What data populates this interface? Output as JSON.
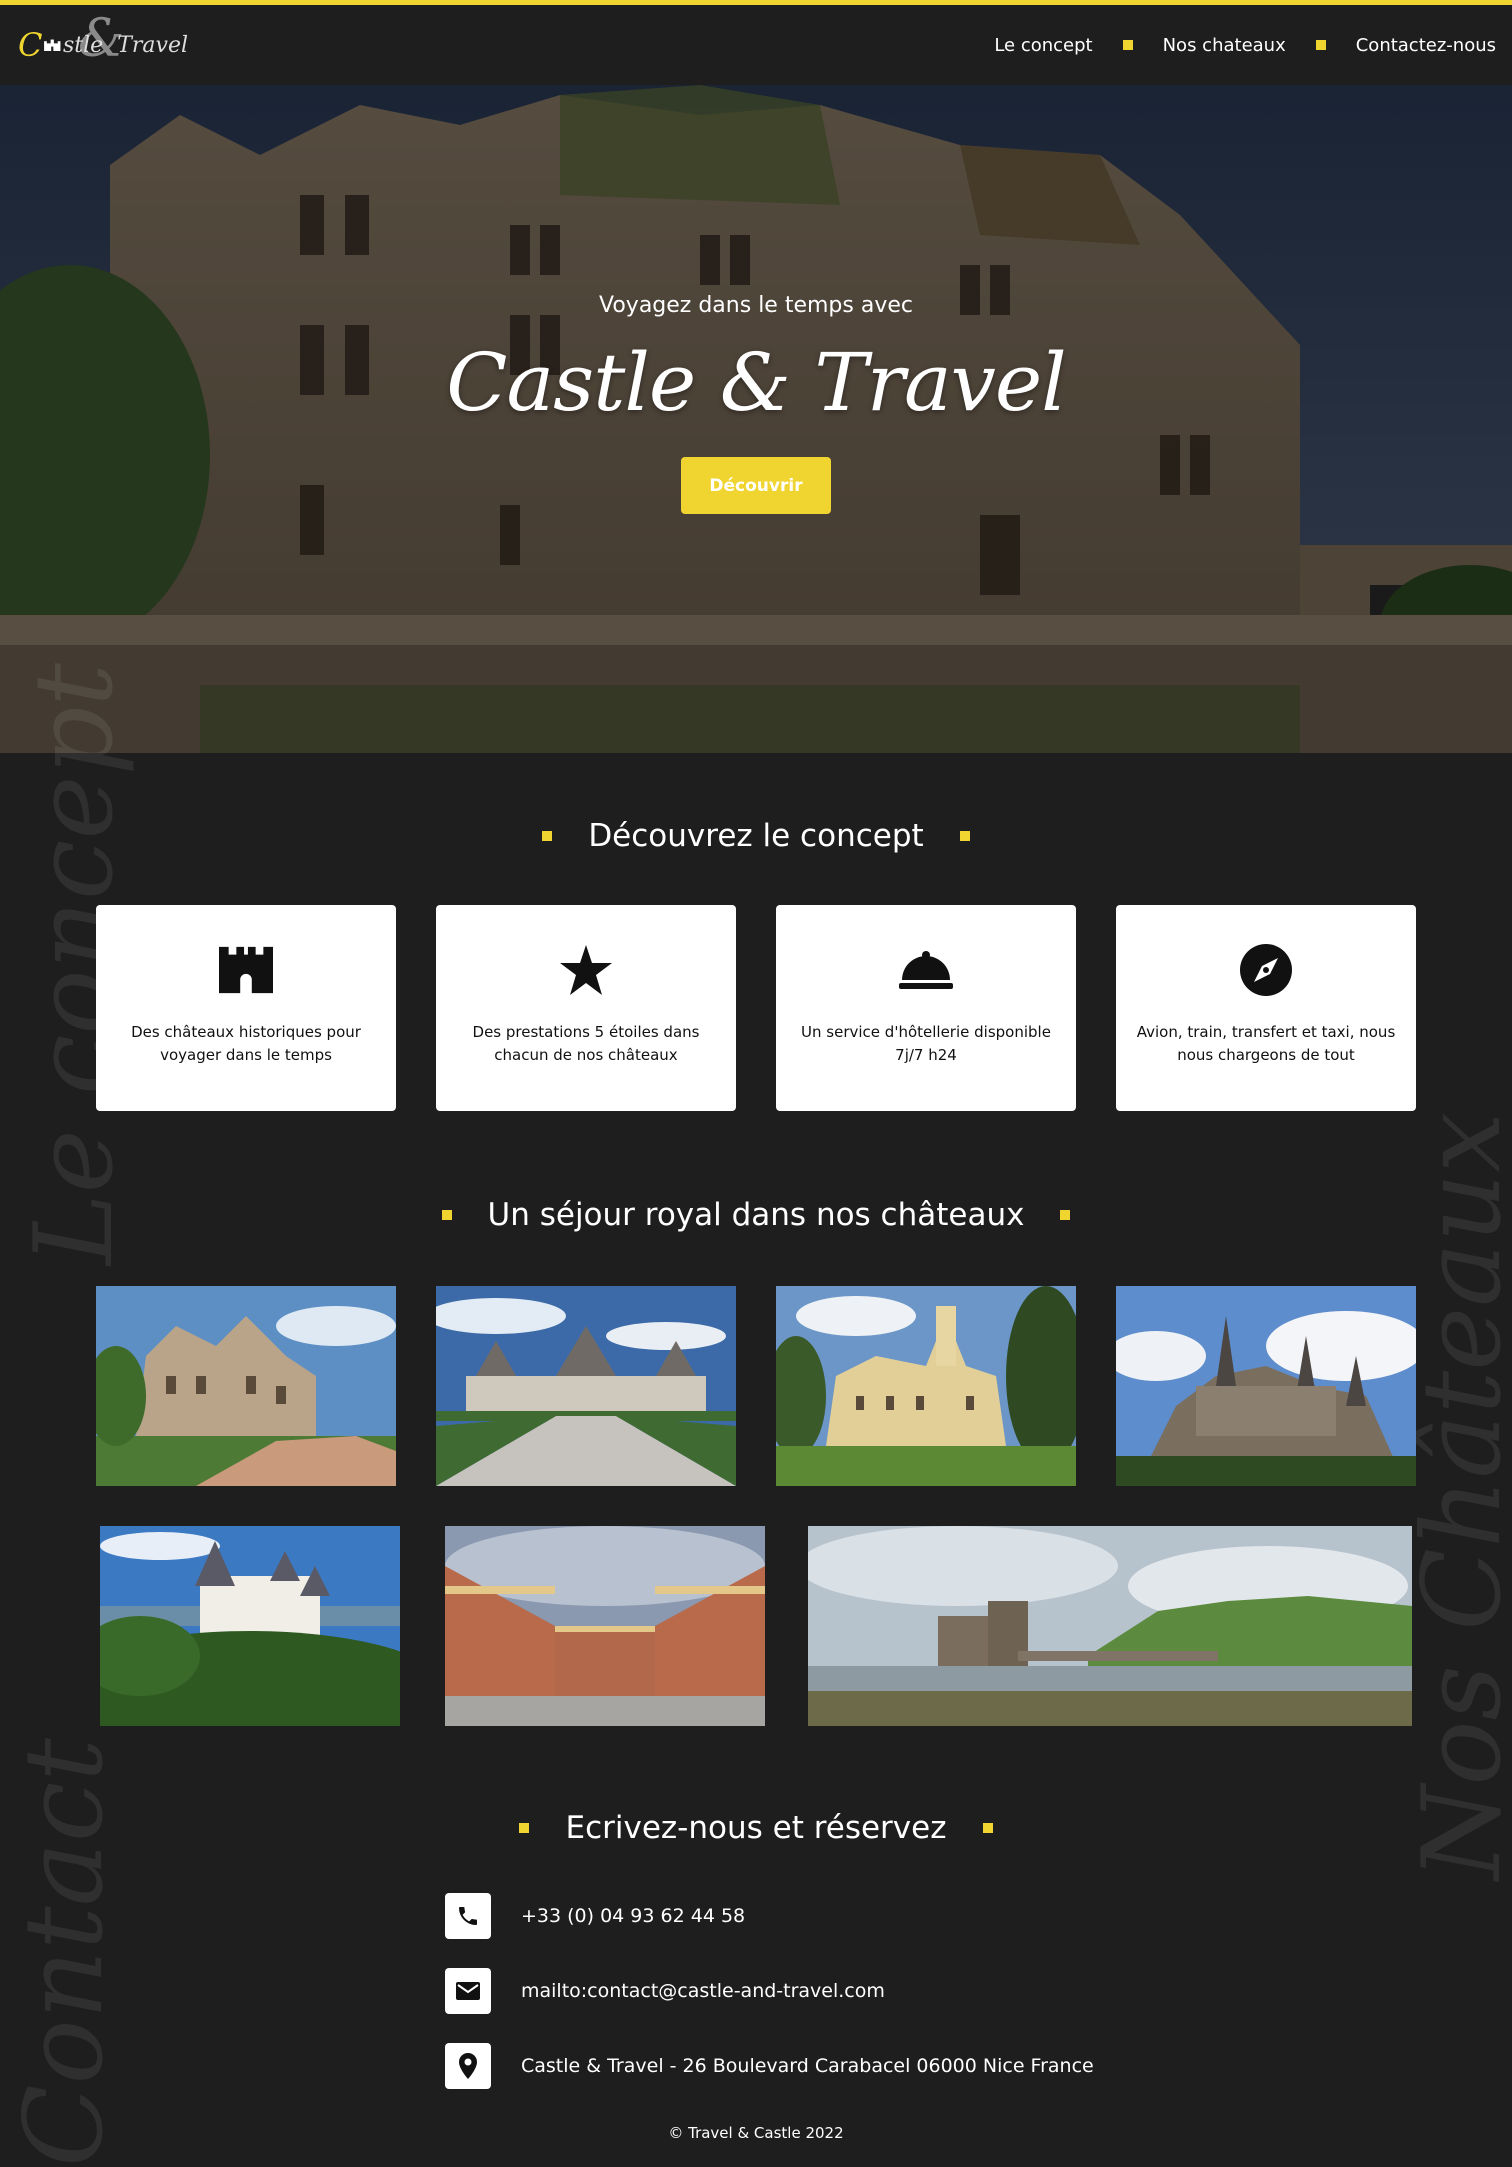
{
  "brand": {
    "logo_first_letter": "C",
    "logo_text": "stle",
    "logo_amp": "&",
    "logo_text2": "Travel",
    "accent_color": "#f0d531",
    "background_color": "#1e1e1e"
  },
  "nav": {
    "items": [
      {
        "label": "Le concept"
      },
      {
        "label": "Nos chateaux"
      },
      {
        "label": "Contactez-nous"
      }
    ]
  },
  "hero": {
    "subtitle": "Voyagez dans le temps avec",
    "title": "Castle & Travel",
    "cta_label": "Découvrir"
  },
  "watermarks": {
    "concept": "Le concept",
    "chateaux": "Nos Châteaux",
    "contact": "Contact"
  },
  "concept": {
    "title": "Découvrez le concept",
    "cards": [
      {
        "icon": "castle-icon",
        "text": "Des châteaux historiques pour voyager dans le temps"
      },
      {
        "icon": "star-icon",
        "text": "Des prestations 5 étoiles dans chacun de nos châteaux"
      },
      {
        "icon": "cloche-icon",
        "text": "Un service d'hôtellerie disponible 7j/7 h24"
      },
      {
        "icon": "compass-icon",
        "text": "Avion, train, transfert et taxi, nous nous chargeons de tout"
      }
    ]
  },
  "chateaux": {
    "title": "Un séjour royal dans nos châteaux"
  },
  "contact": {
    "title": "Ecrivez-nous et réservez",
    "phone": "+33 (0) 04 93 62 44 58",
    "email": "mailto:contact@castle-and-travel.com",
    "address": "Castle & Travel - 26 Boulevard Carabacel 06000 Nice France"
  },
  "footer": {
    "copyright": "© Travel & Castle 2022"
  }
}
